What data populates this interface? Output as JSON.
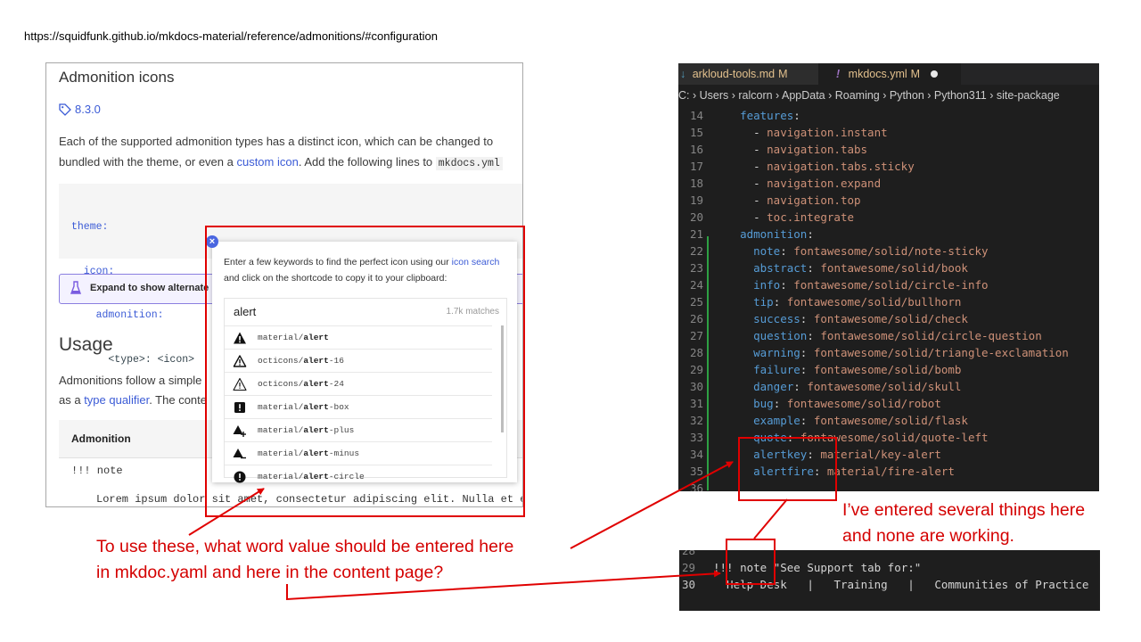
{
  "url": "https://squidfunk.github.io/mkdocs-material/reference/admonitions/#configuration",
  "docs": {
    "heading": "Admonition icons",
    "version": "8.3.0",
    "para_1": "Each of the supported admonition types has a distinct icon, which can be changed to",
    "para_2a": "bundled with the theme, or even a ",
    "para_2_link": "custom icon",
    "para_2b": ". Add the following lines to ",
    "para_2_code": "mkdocs.yml",
    "code_lines": [
      "theme:",
      "  icon:",
      "    admonition:",
      "      <type>: <icon>"
    ],
    "expand_label": "Expand to show alternate ic",
    "usage_heading": "Usage",
    "usage_line_1": "Admonitions follow a simple",
    "usage_line_2a": "as a ",
    "usage_line_2_link": "type qualifier",
    "usage_line_2b": ". The conte",
    "table_header": "Admonition",
    "table_row_1": "!!! note",
    "table_row_2": "Lorem ipsum dolor sit amet, consectetur adipiscing elit. Nulla et eu"
  },
  "popup": {
    "close_glyph": "×",
    "intro_a": "Enter a few keywords to find the perfect icon using our ",
    "intro_link": "icon search",
    "intro_b": " and click on the shortcode to copy it to your clipboard:",
    "query": "alert",
    "matches": "1.7k matches",
    "results": [
      {
        "prefix": "material/",
        "bold": "alert",
        "suffix": "",
        "icon": "alert-icon"
      },
      {
        "prefix": "octicons/",
        "bold": "alert",
        "suffix": "-16",
        "icon": "alert-outline-icon"
      },
      {
        "prefix": "octicons/",
        "bold": "alert",
        "suffix": "-24",
        "icon": "alert-outline-icon"
      },
      {
        "prefix": "material/",
        "bold": "alert",
        "suffix": "-box",
        "icon": "alert-box-icon"
      },
      {
        "prefix": "material/",
        "bold": "alert",
        "suffix": "-plus",
        "icon": "alert-plus-icon"
      },
      {
        "prefix": "material/",
        "bold": "alert",
        "suffix": "-minus",
        "icon": "alert-minus-icon"
      },
      {
        "prefix": "material/",
        "bold": "alert",
        "suffix": "-circle",
        "icon": "alert-circle-icon"
      }
    ]
  },
  "editor": {
    "tab1_label": "arkloud-tools.md",
    "tab1_status": "M",
    "tab2_label": "mkdocs.yml",
    "tab2_status": "M",
    "breadcrumb": "C: › Users › ralcorn › AppData › Roaming › Python › Python311 › site-package",
    "lines": [
      {
        "n": "14",
        "indent": "  ",
        "key": "features",
        "sep": ":",
        "val": ""
      },
      {
        "n": "15",
        "indent": "    - ",
        "key": "",
        "sep": "",
        "val": "navigation.instant"
      },
      {
        "n": "16",
        "indent": "    - ",
        "key": "",
        "sep": "",
        "val": "navigation.tabs"
      },
      {
        "n": "17",
        "indent": "    - ",
        "key": "",
        "sep": "",
        "val": "navigation.tabs.sticky"
      },
      {
        "n": "18",
        "indent": "    - ",
        "key": "",
        "sep": "",
        "val": "navigation.expand"
      },
      {
        "n": "19",
        "indent": "    - ",
        "key": "",
        "sep": "",
        "val": "navigation.top"
      },
      {
        "n": "20",
        "indent": "    - ",
        "key": "",
        "sep": "",
        "val": "toc.integrate"
      },
      {
        "n": "21",
        "indent": "  ",
        "key": "admonition",
        "sep": ":",
        "val": ""
      },
      {
        "n": "22",
        "indent": "    ",
        "key": "note",
        "sep": ": ",
        "val": "fontawesome/solid/note-sticky"
      },
      {
        "n": "23",
        "indent": "    ",
        "key": "abstract",
        "sep": ": ",
        "val": "fontawesome/solid/book"
      },
      {
        "n": "24",
        "indent": "    ",
        "key": "info",
        "sep": ": ",
        "val": "fontawesome/solid/circle-info"
      },
      {
        "n": "25",
        "indent": "    ",
        "key": "tip",
        "sep": ": ",
        "val": "fontawesome/solid/bullhorn"
      },
      {
        "n": "26",
        "indent": "    ",
        "key": "success",
        "sep": ": ",
        "val": "fontawesome/solid/check"
      },
      {
        "n": "27",
        "indent": "    ",
        "key": "question",
        "sep": ": ",
        "val": "fontawesome/solid/circle-question"
      },
      {
        "n": "28",
        "indent": "    ",
        "key": "warning",
        "sep": ": ",
        "val": "fontawesome/solid/triangle-exclamation"
      },
      {
        "n": "29",
        "indent": "    ",
        "key": "failure",
        "sep": ": ",
        "val": "fontawesome/solid/bomb"
      },
      {
        "n": "30",
        "indent": "    ",
        "key": "danger",
        "sep": ": ",
        "val": "fontawesome/solid/skull"
      },
      {
        "n": "31",
        "indent": "    ",
        "key": "bug",
        "sep": ": ",
        "val": "fontawesome/solid/robot"
      },
      {
        "n": "32",
        "indent": "    ",
        "key": "example",
        "sep": ": ",
        "val": "fontawesome/solid/flask"
      },
      {
        "n": "33",
        "indent": "    ",
        "key": "quote",
        "sep": ": ",
        "val": "fontawesome/solid/quote-left"
      },
      {
        "n": "34",
        "indent": "    ",
        "key": "alertkey",
        "sep": ": ",
        "val": "material/key-alert"
      },
      {
        "n": "35",
        "indent": "    ",
        "key": "alertfire",
        "sep": ": ",
        "val": "material/fire-alert"
      },
      {
        "n": "36",
        "indent": "",
        "key": "",
        "sep": "",
        "val": ""
      }
    ]
  },
  "terminal": {
    "lines": [
      {
        "n": "28",
        "text": ""
      },
      {
        "n": "29",
        "text": "!!! note \"See Support tab for:\""
      },
      {
        "n": "30",
        "text": "  Help Desk   |   Training   |   Communities of Practice"
      }
    ]
  },
  "annotations": {
    "question_line_1": "To use these, what word value should be entered here",
    "question_line_2": "in mkdoc.yaml and here in the content page?",
    "note_line_1": "I’ve entered several things here",
    "note_line_2": "and none are working."
  },
  "colors": {
    "annotation_red": "#e00000",
    "link_blue": "#3b5bd6",
    "yaml_key": "#569cd6",
    "yaml_value": "#ce9178",
    "modified_tab": "#e2c08d"
  }
}
